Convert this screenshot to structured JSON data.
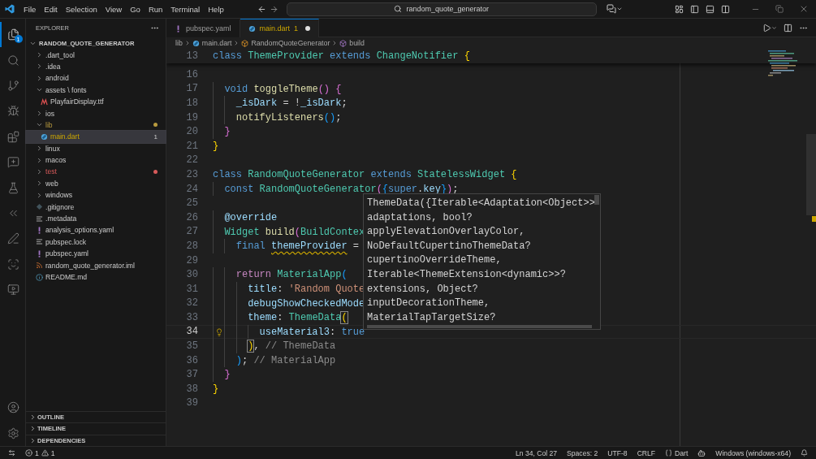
{
  "title_bar": {
    "menu": [
      "File",
      "Edit",
      "Selection",
      "View",
      "Go",
      "Run",
      "Terminal",
      "Help"
    ],
    "search": "random_quote_generator"
  },
  "activity_bar": {
    "items": [
      {
        "kind": "explorer",
        "selected": true,
        "badge": "1"
      },
      {
        "kind": "search",
        "selected": false
      },
      {
        "kind": "source-control",
        "selected": false
      },
      {
        "kind": "run",
        "selected": false
      },
      {
        "kind": "extensions",
        "selected": false
      },
      {
        "kind": "chat",
        "selected": false
      },
      {
        "kind": "testing",
        "selected": false
      },
      {
        "kind": "flutter",
        "selected": false
      },
      {
        "kind": "pen",
        "selected": false
      },
      {
        "kind": "scan",
        "selected": false
      },
      {
        "kind": "preview",
        "selected": false
      }
    ],
    "bottom": [
      {
        "kind": "account",
        "selected": false
      },
      {
        "kind": "settings",
        "selected": false
      }
    ]
  },
  "sidebar": {
    "title": "EXPLORER",
    "root": {
      "label": "RANDOM_QUOTE_GENERATOR",
      "expanded": true,
      "selected": false,
      "children": [
        {
          "label": ".dart_tool",
          "kind": "folder",
          "expanded": false,
          "selected": false
        },
        {
          "label": ".idea",
          "kind": "folder",
          "expanded": false,
          "selected": false
        },
        {
          "label": "android",
          "kind": "folder",
          "expanded": false,
          "selected": false
        },
        {
          "label": "assets \\ fonts",
          "kind": "folder",
          "expanded": true,
          "selected": false,
          "children": [
            {
              "label": "PlayfairDisplay.ttf",
              "kind": "font",
              "selected": false
            }
          ]
        },
        {
          "label": "ios",
          "kind": "folder",
          "expanded": false,
          "selected": false
        },
        {
          "label": "lib",
          "kind": "folder",
          "expanded": true,
          "selected": false,
          "color": "#b89a3e",
          "dot": true,
          "children": [
            {
              "label": "main.dart",
              "kind": "dart",
              "selected": true,
              "warning": true,
              "badge": "1"
            }
          ]
        },
        {
          "label": "linux",
          "kind": "folder",
          "expanded": false,
          "selected": false
        },
        {
          "label": "macos",
          "kind": "folder",
          "expanded": false,
          "selected": false
        },
        {
          "label": "test",
          "kind": "folder",
          "expanded": false,
          "selected": false,
          "color": "#d65a5a",
          "dot": true
        },
        {
          "label": "web",
          "kind": "folder",
          "expanded": false,
          "selected": false
        },
        {
          "label": "windows",
          "kind": "folder",
          "expanded": false,
          "selected": false
        },
        {
          "label": ".gitignore",
          "kind": "git",
          "selected": false
        },
        {
          "label": ".metadata",
          "kind": "lines",
          "selected": false
        },
        {
          "label": "analysis_options.yaml",
          "kind": "yaml",
          "selected": false
        },
        {
          "label": "pubspec.lock",
          "kind": "lines",
          "selected": false
        },
        {
          "label": "pubspec.yaml",
          "kind": "yaml",
          "selected": false
        },
        {
          "label": "random_quote_generator.iml",
          "kind": "xml",
          "selected": false
        },
        {
          "label": "README.md",
          "kind": "info",
          "selected": false
        }
      ]
    },
    "sections": [
      {
        "label": "OUTLINE",
        "expanded": false
      },
      {
        "label": "TIMELINE",
        "expanded": false
      },
      {
        "label": "DEPENDENCIES",
        "expanded": false
      }
    ]
  },
  "editor": {
    "tabs": [
      {
        "label": "pubspec.yaml",
        "kind": "yaml",
        "selected": false,
        "modified": false
      },
      {
        "label": "main.dart",
        "kind": "dart",
        "selected": true,
        "modified": true,
        "badge": "1"
      }
    ],
    "breadcrumbs": [
      {
        "label": "lib",
        "kind": "folder"
      },
      {
        "label": "main.dart",
        "kind": "dart"
      },
      {
        "label": "RandomQuoteGenerator",
        "kind": "class"
      },
      {
        "label": "build",
        "kind": "method"
      }
    ],
    "sticky": {
      "number": "13",
      "tokens": [
        {
          "text": "class ",
          "kind": "keyword"
        },
        {
          "text": "ThemeProvider ",
          "kind": "type"
        },
        {
          "text": "extends ",
          "kind": "keyword"
        },
        {
          "text": "ChangeNotifier ",
          "kind": "type"
        },
        {
          "text": "{",
          "kind": "bracket1"
        }
      ]
    },
    "lines": [
      {
        "number": "16",
        "current": false
      },
      {
        "number": "17",
        "current": false,
        "tokens": [
          {
            "text": "  void ",
            "kind": "keyword"
          },
          {
            "text": "toggleTheme",
            "kind": "function"
          },
          {
            "text": "() {",
            "kind": "bracket2"
          }
        ]
      },
      {
        "number": "18",
        "current": false,
        "tokens": [
          {
            "text": "    _isDark",
            "kind": "variable"
          },
          {
            "text": " = !",
            "kind": "plain"
          },
          {
            "text": "_isDark",
            "kind": "variable"
          },
          {
            "text": ";",
            "kind": "plain"
          }
        ]
      },
      {
        "number": "19",
        "current": false,
        "tokens": [
          {
            "text": "    notifyListeners",
            "kind": "function"
          },
          {
            "text": "()",
            "kind": "bracket3"
          },
          {
            "text": ";",
            "kind": "plain"
          }
        ]
      },
      {
        "number": "20",
        "current": false,
        "tokens": [
          {
            "text": "  }",
            "kind": "bracket2"
          }
        ]
      },
      {
        "number": "21",
        "current": false,
        "tokens": [
          {
            "text": "}",
            "kind": "bracket1"
          }
        ]
      },
      {
        "number": "22",
        "current": false
      },
      {
        "number": "23",
        "current": false,
        "tokens": [
          {
            "text": "class ",
            "kind": "keyword"
          },
          {
            "text": "RandomQuoteGenerator ",
            "kind": "type"
          },
          {
            "text": "extends ",
            "kind": "keyword"
          },
          {
            "text": "StatelessWidget ",
            "kind": "type"
          },
          {
            "text": "{",
            "kind": "bracket1"
          }
        ]
      },
      {
        "number": "24",
        "current": false,
        "tokens": [
          {
            "text": "  const ",
            "kind": "keyword"
          },
          {
            "text": "RandomQuoteGenerator",
            "kind": "type"
          },
          {
            "text": "(",
            "kind": "bracket2"
          },
          {
            "text": "{",
            "kind": "bracket3"
          },
          {
            "text": "super",
            "kind": "keyword"
          },
          {
            "text": ".",
            "kind": "plain"
          },
          {
            "text": "key",
            "kind": "variable"
          },
          {
            "text": "}",
            "kind": "bracket3"
          },
          {
            "text": ")",
            "kind": "bracket2"
          },
          {
            "text": ";",
            "kind": "plain"
          }
        ]
      },
      {
        "number": "25",
        "current": false
      },
      {
        "number": "26",
        "current": false,
        "tokens": [
          {
            "text": "  @override",
            "kind": "variable"
          }
        ]
      },
      {
        "number": "27",
        "current": false,
        "tokens": [
          {
            "text": "  Widget ",
            "kind": "type"
          },
          {
            "text": "build",
            "kind": "function"
          },
          {
            "text": "(",
            "kind": "bracket2"
          },
          {
            "text": "BuildContex",
            "kind": "type"
          }
        ]
      },
      {
        "number": "28",
        "current": false,
        "tokens": [
          {
            "text": "    final ",
            "kind": "keyword"
          },
          {
            "text": "themeProvider",
            "kind": "variable",
            "warning": true
          },
          {
            "text": " =",
            "kind": "plain"
          }
        ]
      },
      {
        "number": "29",
        "current": false
      },
      {
        "number": "30",
        "current": false,
        "tokens": [
          {
            "text": "    return ",
            "kind": "control"
          },
          {
            "text": "MaterialApp",
            "kind": "type"
          },
          {
            "text": "(",
            "kind": "bracket3"
          }
        ]
      },
      {
        "number": "31",
        "current": false,
        "tokens": [
          {
            "text": "      title",
            "kind": "variable"
          },
          {
            "text": ": ",
            "kind": "plain"
          },
          {
            "text": "'Random Quote",
            "kind": "string"
          }
        ]
      },
      {
        "number": "32",
        "current": false,
        "tokens": [
          {
            "text": "      debugShowCheckedMode",
            "kind": "variable"
          }
        ]
      },
      {
        "number": "33",
        "current": false,
        "tokens": [
          {
            "text": "      theme",
            "kind": "variable"
          },
          {
            "text": ": ",
            "kind": "plain"
          },
          {
            "text": "ThemeData",
            "kind": "type"
          },
          {
            "text": "(",
            "kind": "bracket1",
            "matched": true
          }
        ]
      },
      {
        "number": "34",
        "current": true,
        "lightbulb": true,
        "tokens": [
          {
            "text": "        useMaterial3",
            "kind": "variable"
          },
          {
            "text": ": ",
            "kind": "plain"
          },
          {
            "text": "true",
            "kind": "keyword"
          }
        ]
      },
      {
        "number": "35",
        "current": false,
        "tokens": [
          {
            "text": "      )",
            "kind": "bracket1",
            "matched": true
          },
          {
            "text": ", ",
            "kind": "plain"
          },
          {
            "text": "// ThemeData",
            "kind": "hint"
          }
        ]
      },
      {
        "number": "36",
        "current": false,
        "tokens": [
          {
            "text": "    )",
            "kind": "bracket3"
          },
          {
            "text": "; ",
            "kind": "plain"
          },
          {
            "text": "// MaterialApp",
            "kind": "hint"
          }
        ]
      },
      {
        "number": "37",
        "current": false,
        "tokens": [
          {
            "text": "  }",
            "kind": "bracket2"
          }
        ]
      },
      {
        "number": "38",
        "current": false,
        "tokens": [
          {
            "text": "}",
            "kind": "bracket1"
          }
        ]
      },
      {
        "number": "39",
        "current": false
      }
    ],
    "hover": {
      "lines": [
        "ThemeData({Iterable<Adaptation<Object>>",
        "adaptations, bool?",
        "applyElevationOverlayColor,",
        "NoDefaultCupertinoThemeData?",
        "cupertinoOverrideTheme,",
        "Iterable<ThemeExtension<dynamic>>?",
        "extensions, Object?",
        "inputDecorationTheme,",
        "MaterialTapTargetSize?"
      ]
    }
  },
  "status_bar": {
    "errors": "1",
    "warnings": "1",
    "position": "Ln 34, Col 27",
    "spaces": "Spaces: 2",
    "encoding": "UTF-8",
    "eol": "CRLF",
    "language": "Dart",
    "platform": "Windows (windows-x64)"
  }
}
